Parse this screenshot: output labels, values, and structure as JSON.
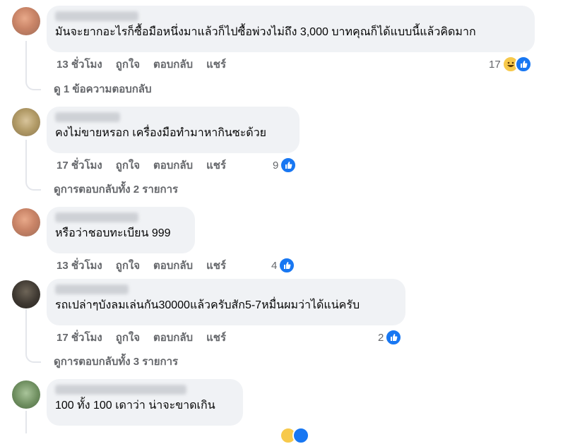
{
  "comments": [
    {
      "text": "มันจะยากอะไรก็ซื้อมือหนึ่งมาแล้วก็ไปซื้อพ่วงไม่ถึง 3,000 บาทคุณก็ได้แบบนี้แล้วคิดมาก",
      "time": "13 ชั่วโมง",
      "reaction_count": "17",
      "reactions": [
        "haha-icon",
        "like-icon"
      ],
      "view_replies": "ดู 1 ข้อความตอบกลับ"
    },
    {
      "text": "คงไม่ขายหรอก เครื่องมือทำมาหากินซะด้วย",
      "time": "17 ชั่วโมง",
      "reaction_count": "9",
      "reactions": [
        "like-icon"
      ],
      "view_replies": "ดูการตอบกลับทั้ง 2 รายการ"
    },
    {
      "text": "หรือว่าชอบทะเบียน 999",
      "time": "13 ชั่วโมง",
      "reaction_count": "4",
      "reactions": [
        "like-icon"
      ]
    },
    {
      "text": "รถเปล่าๆบังลมเล่นกัน30000แล้วครับสัก5-7หมื่นผมว่าได้แน่ครับ",
      "time": "17 ชั่วโมง",
      "reaction_count": "2",
      "reactions": [
        "like-icon"
      ],
      "view_replies": "ดูการตอบกลับทั้ง 3 รายการ"
    },
    {
      "text": "100 ทั้ง 100 เดาว่า น่าจะขาดเกิน",
      "reactions": [
        "haha-icon",
        "like-icon"
      ]
    }
  ],
  "actions": {
    "like": "ถูกใจ",
    "reply": "ตอบกลับ",
    "share": "แชร์"
  },
  "colors": {
    "bubble": "#f0f2f5",
    "meta_text": "#65676b",
    "like_blue": "#1877f2",
    "haha_yellow": "#f7c94b"
  }
}
